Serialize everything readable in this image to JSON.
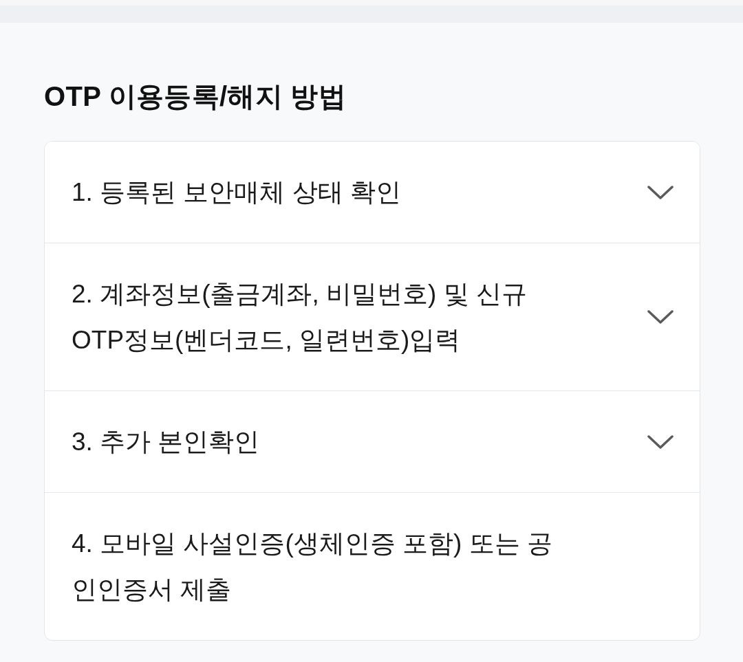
{
  "heading": "OTP 이용등록/해지 방법",
  "steps": [
    {
      "kind": "accordion",
      "label": "1. 등록된 보안매체 상태 확인"
    },
    {
      "kind": "accordion",
      "label": "2. 계좌정보(출금계좌, 비밀번호) 및 신규 OTP정보(벤더코드, 일련번호)입력"
    },
    {
      "kind": "accordion",
      "label": "3. 추가 본인확인"
    },
    {
      "kind": "text",
      "label": "4. 모바일 사설인증(생체인증 포함) 또는 공인인증서 제출"
    }
  ]
}
